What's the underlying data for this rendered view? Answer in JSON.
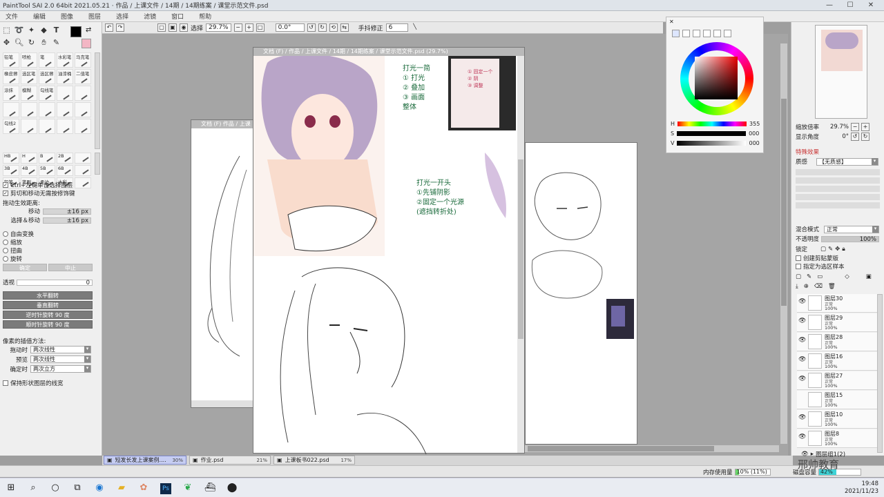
{
  "window": {
    "title": "PaintTool SAI 2.0 64bit 2021.05.21 · 作品 / 上课文件 / 14期 / 14期练案 / 课堂示范文件.psd",
    "controls": [
      "—",
      "☐",
      "✕"
    ]
  },
  "menu": [
    "文件",
    "编辑",
    "图像",
    "图层",
    "选择",
    "滤镜",
    "窗口",
    "帮助"
  ],
  "toolbar": {
    "selection_label": "选择",
    "zoom": "29.7%",
    "angle": "0.0°",
    "stabilizer_label": "手抖修正",
    "stabilizer_value": "6"
  },
  "tools": {
    "icons": [
      "select-rect-icon",
      "lasso-icon",
      "magic-wand-icon",
      "fill-icon",
      "text-icon",
      "swap-icon",
      "move-icon",
      "zoom-icon",
      "rotate-icon",
      "hand-icon",
      "eyedropper-icon",
      "eraser-icon"
    ],
    "brushes": [
      "铅笔",
      "喷枪",
      "笔",
      "水彩笔",
      "马克笔",
      "橡皮擦",
      "选区笔",
      "选区擦",
      "油漆桶",
      "二值笔",
      "涂抹",
      "模糊",
      "勾线笔",
      "",
      "",
      "",
      "",
      "",
      "",
      "",
      "勾线2",
      "",
      "",
      "",
      ""
    ],
    "sizes": [
      "HB",
      "H",
      "B",
      "2B",
      "",
      "3B",
      "4B",
      "5B",
      "6B",
      "",
      "铅笔",
      "笔刷",
      "柔边",
      "水彩",
      ""
    ]
  },
  "left_options": {
    "ctrl_click": "Ctrl+左键单击选择图层",
    "cut_move": "剪切和移动无需按修饰键",
    "drag_threshold": "拖动生效距离:",
    "move_label": "移动",
    "move_value": "±16 px",
    "select_move_label": "选择＆移动",
    "select_move_value": "±16 px",
    "free_transform": "自由变换",
    "scale": "缩放",
    "distort": "扭曲",
    "rotate": "旋转",
    "confirm": "确定",
    "cancel": "中止",
    "perspective_label": "透视",
    "perspective_value": "0",
    "flip_h": "水平翻转",
    "flip_v": "垂直翻转",
    "rot_ccw": "逆时针旋转 90 度",
    "rot_cw": "顺时针旋转 90 度",
    "interp_label": "像素的插值方法:",
    "while_drag_label": "拖动时",
    "while_drag_value": "两次线性",
    "preview_label": "预览",
    "preview_value": "两次线性",
    "confirm_label": "确定时",
    "confirm_value": "两次立方",
    "keep_shape": "保持形状图层的线宽"
  },
  "docs": {
    "back_title": "文档 (F) 作品 / 上课 ...",
    "mid_title": "文档 (F) / 作品 / 上课文件 / 14期 / 14期练案 / 课堂示范文件.psd (29.7%)",
    "front_title": "文档 (F) / 作品 / 上课文件 / 14期 / 14期练案 / 作业.psd (21%)"
  },
  "notes": {
    "block1": [
      "打光一简",
      "① 打光",
      "② 叠加",
      "③ 画面",
      "   整体"
    ],
    "block2": [
      "打光一开头",
      "①先铺阴影",
      "②固定一个光源",
      "(遮挡转折处)"
    ],
    "block3": [
      "① 固定一个",
      "② 阴",
      "③ 调整"
    ]
  },
  "color_panel": {
    "h_label": "H",
    "h_value": "355",
    "s_label": "S",
    "s_value": "000",
    "v_label": "V",
    "v_value": "000"
  },
  "right_panel": {
    "zoom_label": "缩放倍率",
    "zoom_value": "29.7%",
    "angle_label": "显示角度",
    "angle_value": "0°",
    "effects_label": "特殊效果",
    "texture_label": "质感",
    "texture_value": "【无质感】",
    "blend_label": "混合模式",
    "blend_value": "正常",
    "opacity_label": "不透明度",
    "opacity_value": "100%",
    "lock_label": "锁定",
    "clip_label": "创建剪贴蒙版",
    "select_src_label": "指定为选区样本",
    "layers": [
      {
        "name": "图层30",
        "mode": "正常",
        "opacity": "100%"
      },
      {
        "name": "图层29",
        "mode": "正常",
        "opacity": "100%"
      },
      {
        "name": "图层28",
        "mode": "正常",
        "opacity": "100%"
      },
      {
        "name": "图层16",
        "mode": "正常",
        "opacity": "100%"
      },
      {
        "name": "图层27",
        "mode": "正常",
        "opacity": "100%"
      },
      {
        "name": "图层15",
        "mode": "正常",
        "opacity": "100%"
      },
      {
        "name": "图层10",
        "mode": "正常",
        "opacity": "100%"
      },
      {
        "name": "图层8",
        "mode": "正常",
        "opacity": "100%"
      }
    ],
    "group_label": "图层组1(2)"
  },
  "doc_tabs": [
    {
      "name": "短发长发上课案例....",
      "pct": "30%"
    },
    {
      "name": "作业.psd",
      "pct": "21%"
    },
    {
      "name": "上课板书022.psd",
      "pct": "17%"
    }
  ],
  "status": {
    "mem_label": "内存使用量",
    "mem_value": "10% (11%)",
    "mem_fraction": 0.1,
    "disk_label": "磁盘容量",
    "disk_value": "42%",
    "disk_fraction": 0.42,
    "watermark": "邢帅教育"
  },
  "taskbar": {
    "icons": [
      "windows-start-icon",
      "search-icon",
      "cortana-icon",
      "task-view-icon",
      "edge-icon",
      "explorer-icon",
      "paint-icon",
      "photoshop-icon",
      "sai-icon",
      "app-icon",
      "obs-icon"
    ],
    "time": "19:48",
    "date": "2021/11/23"
  }
}
